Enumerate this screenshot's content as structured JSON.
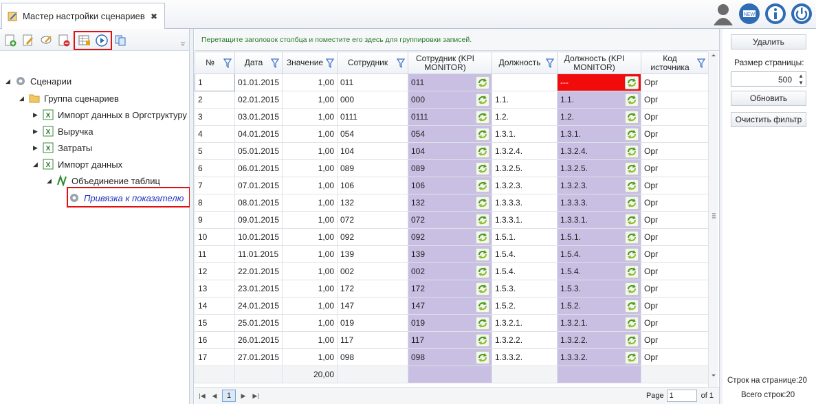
{
  "tab": {
    "title": "Мастер настройки сценариев",
    "close": "✖"
  },
  "tree": [
    {
      "label": "Сценарии",
      "level": 0
    },
    {
      "label": "Группа сценариев",
      "level": 1
    },
    {
      "label": "Импорт данных в Оргструктуру",
      "level": 2
    },
    {
      "label": "Выручка",
      "level": 2
    },
    {
      "label": "Затраты",
      "level": 2
    },
    {
      "label": "Импорт данных",
      "level": 2
    },
    {
      "label": "Объединение таблиц",
      "level": 3
    },
    {
      "label": "Привязка к показателю",
      "level": 4
    }
  ],
  "grid": {
    "group_hint": "Перетащите заголовок столбца и поместите его здесь для группировки записей.",
    "columns": [
      "№",
      "Дата",
      "Значение",
      "Сотрудник",
      "Сотрудник (KPI MONITOR)",
      "Должность",
      "Должность (KPI MONITOR)",
      "Код источника"
    ],
    "rows": [
      [
        "1",
        "01.01.2015",
        "1,00",
        "011",
        "011",
        "",
        "---",
        "Орг"
      ],
      [
        "2",
        "02.01.2015",
        "1,00",
        "000",
        "000",
        "1.1.",
        "1.1.",
        "Орг"
      ],
      [
        "3",
        "03.01.2015",
        "1,00",
        "0111",
        "0111",
        "1.2.",
        "1.2.",
        "Орг"
      ],
      [
        "4",
        "04.01.2015",
        "1,00",
        "054",
        "054",
        "1.3.1.",
        "1.3.1.",
        "Орг"
      ],
      [
        "5",
        "05.01.2015",
        "1,00",
        "104",
        "104",
        "1.3.2.4.",
        "1.3.2.4.",
        "Орг"
      ],
      [
        "6",
        "06.01.2015",
        "1,00",
        "089",
        "089",
        "1.3.2.5.",
        "1.3.2.5.",
        "Орг"
      ],
      [
        "7",
        "07.01.2015",
        "1,00",
        "106",
        "106",
        "1.3.2.3.",
        "1.3.2.3.",
        "Орг"
      ],
      [
        "8",
        "08.01.2015",
        "1,00",
        "132",
        "132",
        "1.3.3.3.",
        "1.3.3.3.",
        "Орг"
      ],
      [
        "9",
        "09.01.2015",
        "1,00",
        "072",
        "072",
        "1.3.3.1.",
        "1.3.3.1.",
        "Орг"
      ],
      [
        "10",
        "10.01.2015",
        "1,00",
        "092",
        "092",
        "1.5.1.",
        "1.5.1.",
        "Орг"
      ],
      [
        "11",
        "11.01.2015",
        "1,00",
        "139",
        "139",
        "1.5.4.",
        "1.5.4.",
        "Орг"
      ],
      [
        "12",
        "22.01.2015",
        "1,00",
        "002",
        "002",
        "1.5.4.",
        "1.5.4.",
        "Орг"
      ],
      [
        "13",
        "23.01.2015",
        "1,00",
        "172",
        "172",
        "1.5.3.",
        "1.5.3.",
        "Орг"
      ],
      [
        "14",
        "24.01.2015",
        "1,00",
        "147",
        "147",
        "1.5.2.",
        "1.5.2.",
        "Орг"
      ],
      [
        "15",
        "25.01.2015",
        "1,00",
        "019",
        "019",
        "1.3.2.1.",
        "1.3.2.1.",
        "Орг"
      ],
      [
        "16",
        "26.01.2015",
        "1,00",
        "117",
        "117",
        "1.3.2.2.",
        "1.3.2.2.",
        "Орг"
      ],
      [
        "17",
        "27.01.2015",
        "1,00",
        "098",
        "098",
        "1.3.3.2.",
        "1.3.3.2.",
        "Орг"
      ]
    ],
    "total": "20,00"
  },
  "pager": {
    "current": "1",
    "page_label": "Page",
    "page_value": "1",
    "of_label": "of 1"
  },
  "right": {
    "delete": "Удалить",
    "page_size_label": "Размер страницы:",
    "page_size": "500",
    "refresh": "Обновить",
    "clear_filter": "Очистить фильтр",
    "rows_on_page": "Строк на странице:20",
    "total_rows": "Всего строк:20"
  },
  "colors": {
    "kpi": "#c8bfe3",
    "error": "#f10b0b",
    "highlight": "#e01010",
    "hint": "#2a7a2a"
  }
}
